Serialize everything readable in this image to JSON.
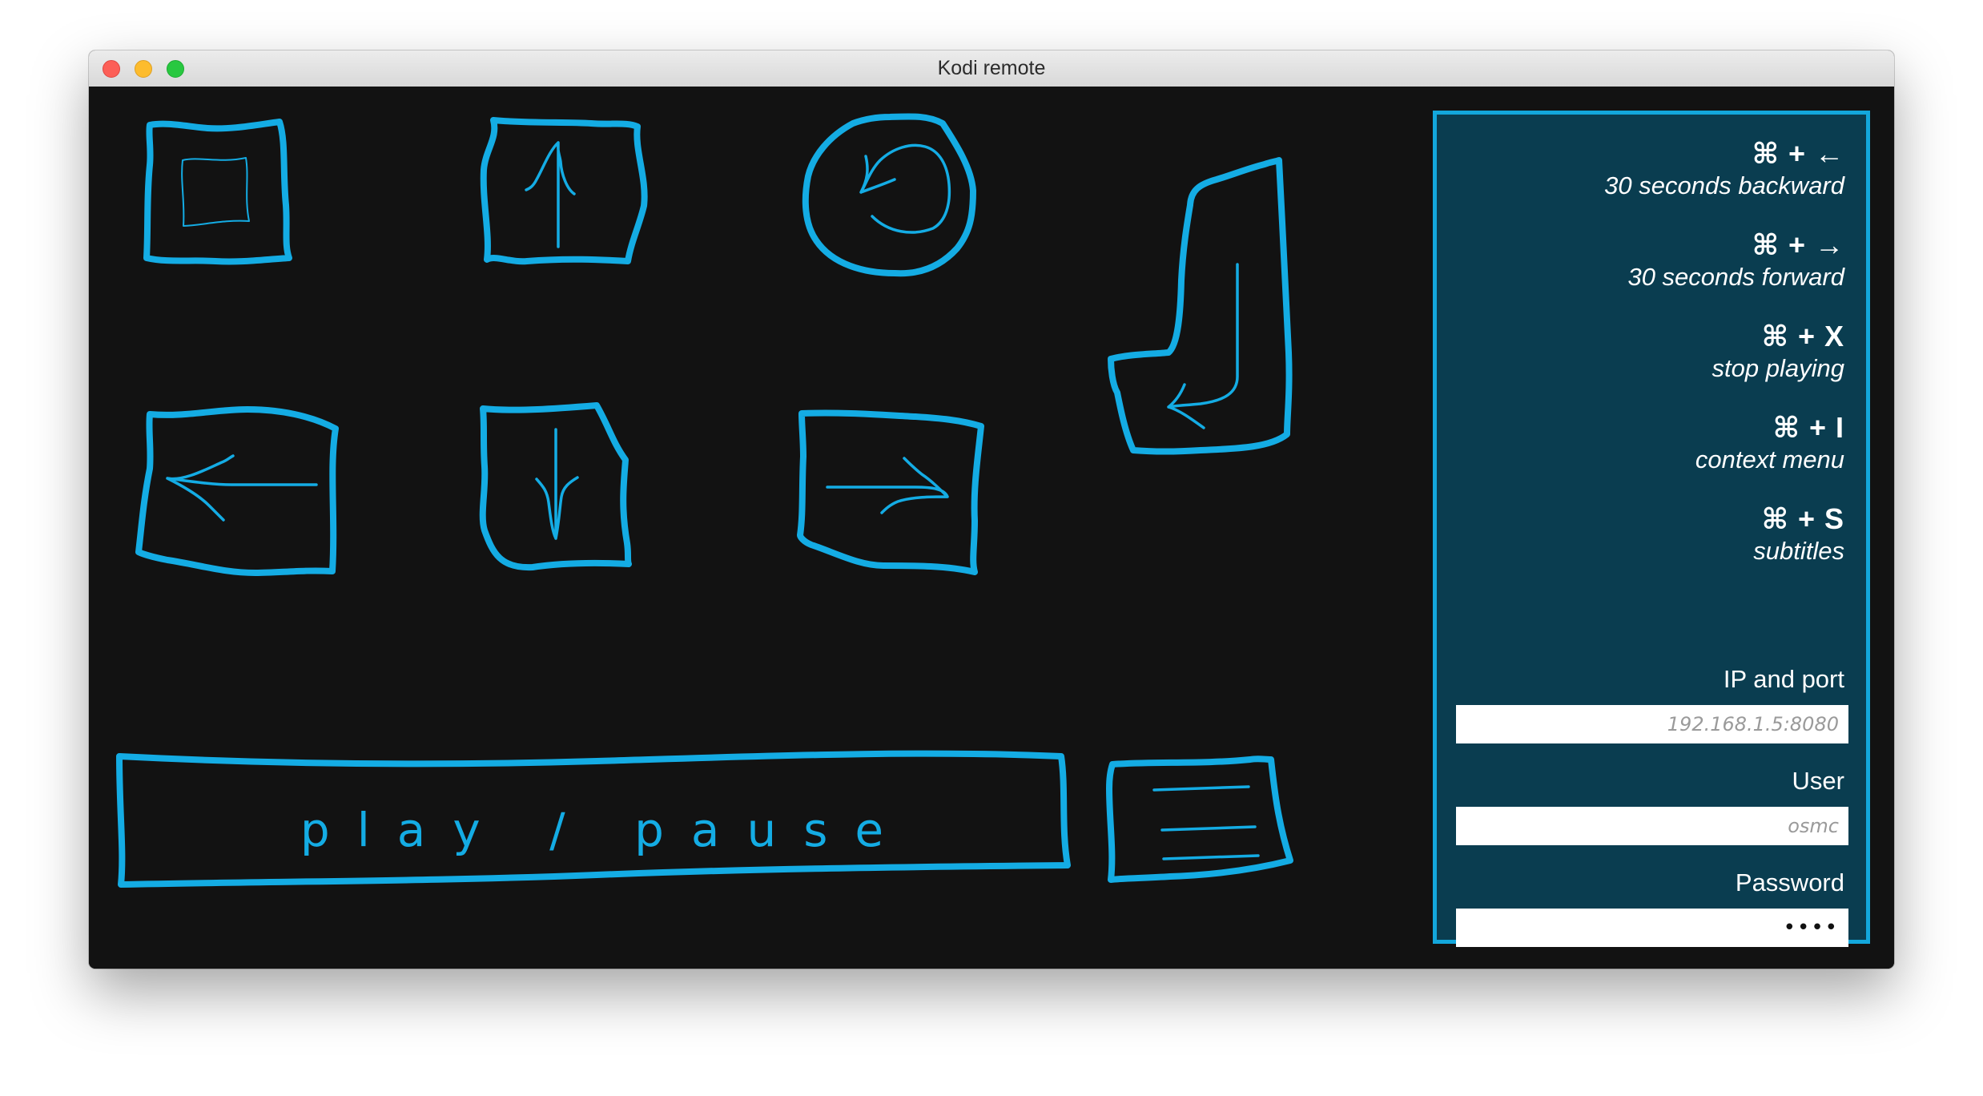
{
  "window": {
    "title": "Kodi remote"
  },
  "colors": {
    "accent": "#14ace4",
    "background": "#121212",
    "panel": "#0a3d50"
  },
  "controls": {
    "play_pause_label": "play / pause",
    "buttons": [
      {
        "name": "stop-button",
        "icon": "stop-icon"
      },
      {
        "name": "up-button",
        "icon": "arrow-up-icon"
      },
      {
        "name": "back-button",
        "icon": "back-circle-icon"
      },
      {
        "name": "enter-button",
        "icon": "enter-return-icon"
      },
      {
        "name": "left-button",
        "icon": "arrow-left-icon"
      },
      {
        "name": "down-button",
        "icon": "arrow-down-icon"
      },
      {
        "name": "right-button",
        "icon": "arrow-right-icon"
      },
      {
        "name": "menu-button",
        "icon": "hamburger-menu-icon"
      }
    ]
  },
  "shortcuts": [
    {
      "keys": "⌘ + ←",
      "description": "30 seconds backward"
    },
    {
      "keys": "⌘ + →",
      "description": "30 seconds forward"
    },
    {
      "keys": "⌘ + X",
      "description": "stop playing"
    },
    {
      "keys": "⌘ + I",
      "description": "context menu"
    },
    {
      "keys": "⌘ + S",
      "description": "subtitles"
    }
  ],
  "settings": {
    "ip": {
      "label": "IP and port",
      "placeholder": "192.168.1.5:8080",
      "value": ""
    },
    "user": {
      "label": "User",
      "placeholder": "osmc",
      "value": ""
    },
    "password": {
      "label": "Password",
      "value": "••••"
    }
  }
}
